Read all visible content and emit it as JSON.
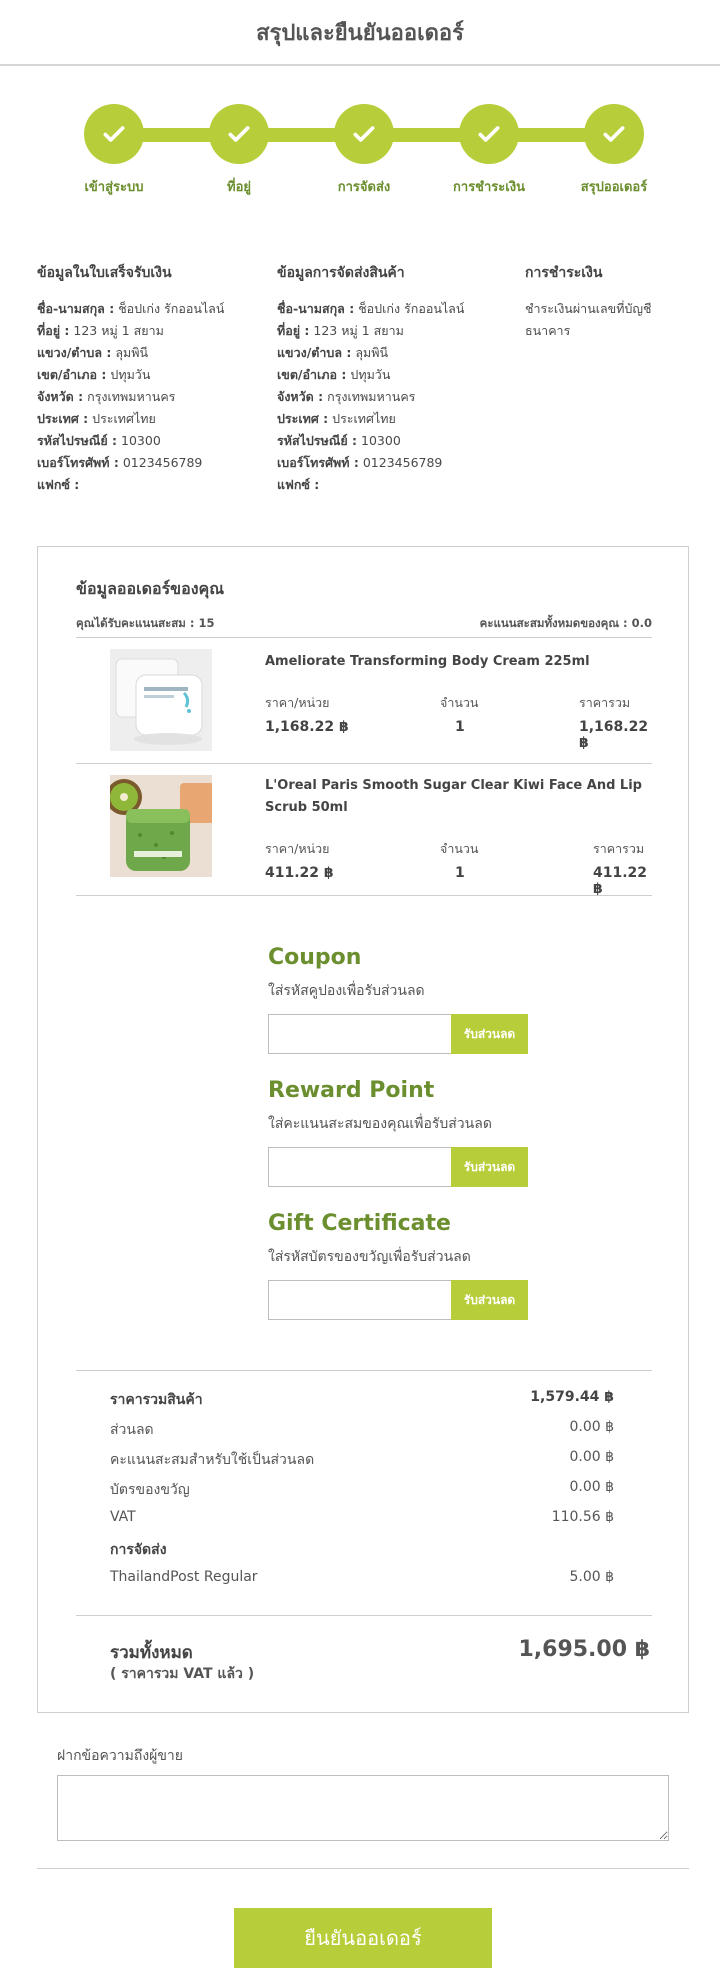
{
  "header": {
    "title": "สรุปและยืนยันออเดอร์"
  },
  "stepper": {
    "steps": [
      {
        "label": "เข้าสู่ระบบ",
        "state": "completed"
      },
      {
        "label": "ที่อยู่",
        "state": "completed"
      },
      {
        "label": "การจัดส่ง",
        "state": "completed"
      },
      {
        "label": "การชำระเงิน",
        "state": "completed"
      },
      {
        "label": "สรุปออเดอร์",
        "state": "completed"
      }
    ],
    "icon": "check-icon",
    "accent_color": "#b8cd3a",
    "label_color": "#6b8e2e"
  },
  "billing": {
    "heading": "ข้อมูลในใบเสร็จรับเงิน",
    "name_label": "ชื่อ-นามสกุล :",
    "name": "ช็อปเก่ง รักออนไลน์",
    "address_label": "ที่อยู่ :",
    "address": "123 หมู่ 1 สยาม",
    "subdistrict_label": "แขวง/ตำบล :",
    "subdistrict": "ลุมพินี",
    "district_label": "เขต/อำเภอ :",
    "district": "ปทุมวัน",
    "province_label": "จังหวัด :",
    "province": "กรุงเทพมหานคร",
    "country_label": "ประเทศ :",
    "country": "ประเทศไทย",
    "postcode_label": "รหัสไปรษณีย์ :",
    "postcode": "10300",
    "phone_label": "เบอร์โทรศัพท์ :",
    "phone": "0123456789",
    "fax_label": "แฟกซ์ :",
    "fax": ""
  },
  "shipping": {
    "heading": "ข้อมูลการจัดส่งสินค้า",
    "name_label": "ชื่อ-นามสกุล :",
    "name": "ช็อปเก่ง รักออนไลน์",
    "address_label": "ที่อยู่ :",
    "address": "123 หมู่ 1 สยาม",
    "subdistrict_label": "แขวง/ตำบล :",
    "subdistrict": "ลุมพินี",
    "district_label": "เขต/อำเภอ :",
    "district": "ปทุมวัน",
    "province_label": "จังหวัด :",
    "province": "กรุงเทพมหานคร",
    "country_label": "ประเทศ :",
    "country": "ประเทศไทย",
    "postcode_label": "รหัสไปรษณีย์ :",
    "postcode": "10300",
    "phone_label": "เบอร์โทรศัพท์ :",
    "phone": "0123456789",
    "fax_label": "แฟกซ์ :",
    "fax": ""
  },
  "payment": {
    "heading": "การชำระเงิน",
    "method": "ชำระเงินผ่านเลขที่บัญชีธนาคาร"
  },
  "order": {
    "heading": "ข้อมูลออเดอร์ของคุณ",
    "points_earned": "คุณได้รับคะแนนสะสม : 15",
    "points_total": "คะแนนสะสมทั้งหมดของคุณ : 0.0",
    "col_price": "ราคา/หน่วย",
    "col_qty": "จำนวน",
    "col_total": "ราคารวม",
    "items": [
      {
        "name": "Ameliorate Transforming Body Cream 225ml",
        "price": "1,168.22 ฿",
        "qty": "1",
        "total": "1,168.22 ฿"
      },
      {
        "name": "L'Oreal Paris Smooth Sugar Clear Kiwi Face And Lip Scrub 50ml",
        "price": "411.22 ฿",
        "qty": "1",
        "total": "411.22 ฿"
      }
    ]
  },
  "coupon": {
    "title": "Coupon",
    "description": "ใส่รหัสคูปองเพื่อรับส่วนลด",
    "value": "",
    "button": "รับส่วนลด"
  },
  "reward": {
    "title": "Reward Point",
    "description": "ใส่คะแนนสะสมของคุณเพื่อรับส่วนลด",
    "value": "",
    "button": "รับส่วนลด"
  },
  "gift": {
    "title": "Gift Certificate",
    "description": "ใส่รหัสบัตรของขวัญเพื่อรับส่วนลด",
    "value": "",
    "button": "รับส่วนลด"
  },
  "summary": {
    "subtotal_label": "ราคารวมสินค้า",
    "subtotal": "1,579.44 ฿",
    "discount_label": "ส่วนลด",
    "discount": "0.00 ฿",
    "points_label": "คะแนนสะสมสำหรับใช้เป็นส่วนลด",
    "points": "0.00 ฿",
    "gift_label": "บัตรของขวัญ",
    "gift": "0.00 ฿",
    "vat_label": "VAT",
    "vat": "110.56 ฿",
    "shipping_heading": "การจัดส่ง",
    "shipping_method": "ThailandPost Regular",
    "shipping_cost": "5.00 ฿",
    "grand_total_label": "รวมทั้งหมด",
    "grand_total_note": "( ราคารวม VAT แล้ว )",
    "grand_total": "1,695.00 ฿"
  },
  "comment": {
    "label": "ฝากข้อความถึงผู้ขาย",
    "value": ""
  },
  "confirm": {
    "label": "ยืนยันออเดอร์"
  }
}
